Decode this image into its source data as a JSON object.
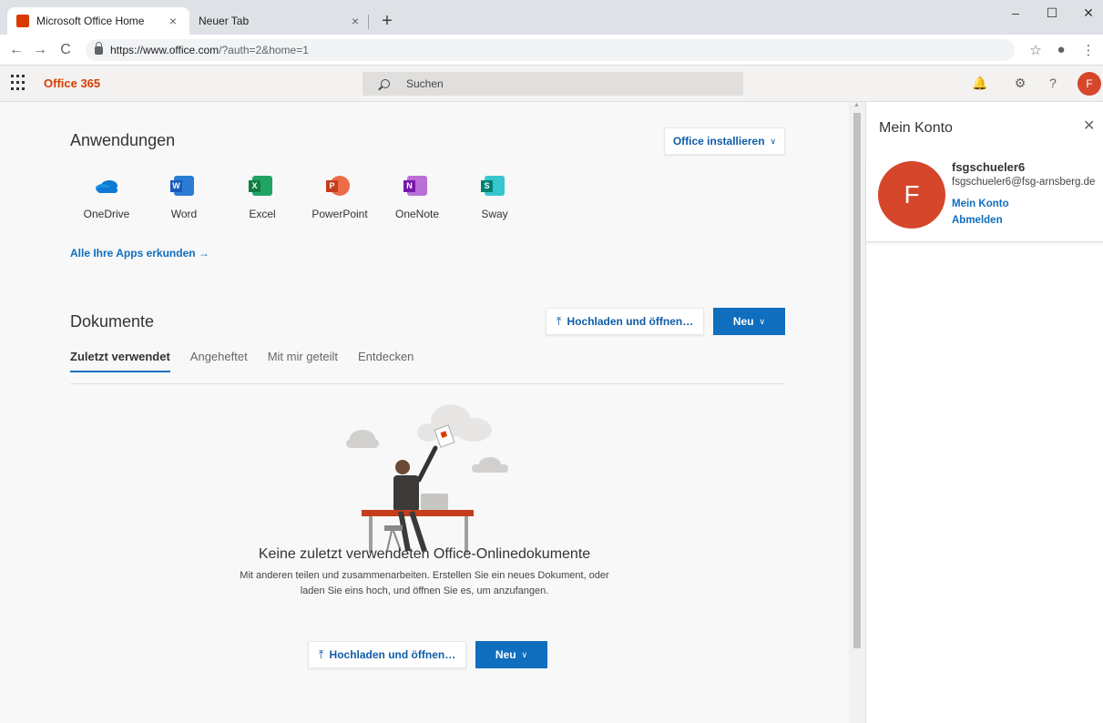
{
  "browser": {
    "tabs": [
      {
        "title": "Microsoft Office Home",
        "close": "×"
      },
      {
        "title": "Neuer Tab",
        "close": "×"
      }
    ],
    "new_tab": "+",
    "window_controls": {
      "minimize": "–",
      "maximize": "☐",
      "close": "✕"
    },
    "nav": {
      "back": "←",
      "forward": "→",
      "reload": "C"
    },
    "url_host": "https://www.office.com",
    "url_path": "/?auth=2&home=1",
    "address_icons": {
      "bookmark": "☆",
      "profile": "●",
      "menu": "⋮"
    }
  },
  "header": {
    "brand": "Office 365",
    "search_placeholder": "Suchen",
    "icons": {
      "bell": "🔔",
      "gear": "⚙",
      "help": "?"
    },
    "avatar_initial": "F"
  },
  "apps_section": {
    "title": "Anwendungen",
    "install_button": "Office installieren",
    "apps": [
      {
        "label": "OneDrive",
        "color": "#0f78d4",
        "letter": ""
      },
      {
        "label": "Word",
        "color": "#185abd",
        "letter": "W"
      },
      {
        "label": "Excel",
        "color": "#107c41",
        "letter": "X"
      },
      {
        "label": "PowerPoint",
        "color": "#c43e1c",
        "letter": "P"
      },
      {
        "label": "OneNote",
        "color": "#7719aa",
        "letter": "N"
      },
      {
        "label": "Sway",
        "color": "#008272",
        "letter": "S"
      }
    ],
    "explore_link": "Alle Ihre Apps erkunden →"
  },
  "docs_section": {
    "title": "Dokumente",
    "upload_button": "Hochladen und öffnen…",
    "new_button": "Neu",
    "tabs": [
      "Zuletzt verwendet",
      "Angeheftet",
      "Mit mir geteilt",
      "Entdecken"
    ],
    "empty_title": "Keine zuletzt verwendeten Office-Onlinedokumente",
    "empty_desc": "Mit anderen teilen und zusammenarbeiten. Erstellen Sie ein neues Dokument, oder laden Sie eins hoch, und öffnen Sie es, um anzufangen.",
    "empty_upload_button": "Hochladen und öffnen…",
    "empty_new_button": "Neu"
  },
  "account_panel": {
    "title": "Mein Konto",
    "close": "✕",
    "avatar_initial": "F",
    "name": "fsgschueler6",
    "email": "fsgschueler6@fsg-arnsberg.de",
    "link_account": "Mein Konto",
    "link_signout": "Abmelden"
  },
  "colors": {
    "accent": "#106ebe",
    "brand": "#d83b01",
    "avatar": "#d5462a"
  }
}
